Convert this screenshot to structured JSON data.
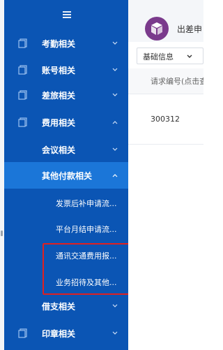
{
  "sidebar": {
    "items": [
      {
        "label": "考勤相关",
        "icon": "document-icon",
        "expanded": false
      },
      {
        "label": "账号相关",
        "icon": "document-icon",
        "expanded": false
      },
      {
        "label": "差旅相关",
        "icon": "document-icon",
        "expanded": false
      },
      {
        "label": "费用相关",
        "icon": "document-icon",
        "expanded": true
      },
      {
        "label": "借支相关",
        "expanded": false
      },
      {
        "label": "印章相关",
        "icon": "document-icon",
        "expanded": false
      }
    ],
    "sub_items": [
      {
        "label": "会议相关",
        "expanded": false
      },
      {
        "label": "其他付款相关",
        "expanded": true,
        "active": true
      }
    ],
    "leaf_items": [
      {
        "label": "发票后补申请流..."
      },
      {
        "label": "平台月结申请流..."
      },
      {
        "label": "通讯交通费用报..."
      },
      {
        "label": "业务招待及其他..."
      }
    ]
  },
  "header": {
    "app_title": "出差申"
  },
  "filter": {
    "selected": "基础信息"
  },
  "table": {
    "columns": [
      "请求编号(点击查"
    ],
    "rows": [
      [
        "300312"
      ]
    ]
  },
  "colors": {
    "sidebar_bg": "#0b55b4",
    "sidebar_active": "#1b76d8",
    "highlight_border": "#e02020",
    "logo": "#7a3a8c"
  }
}
